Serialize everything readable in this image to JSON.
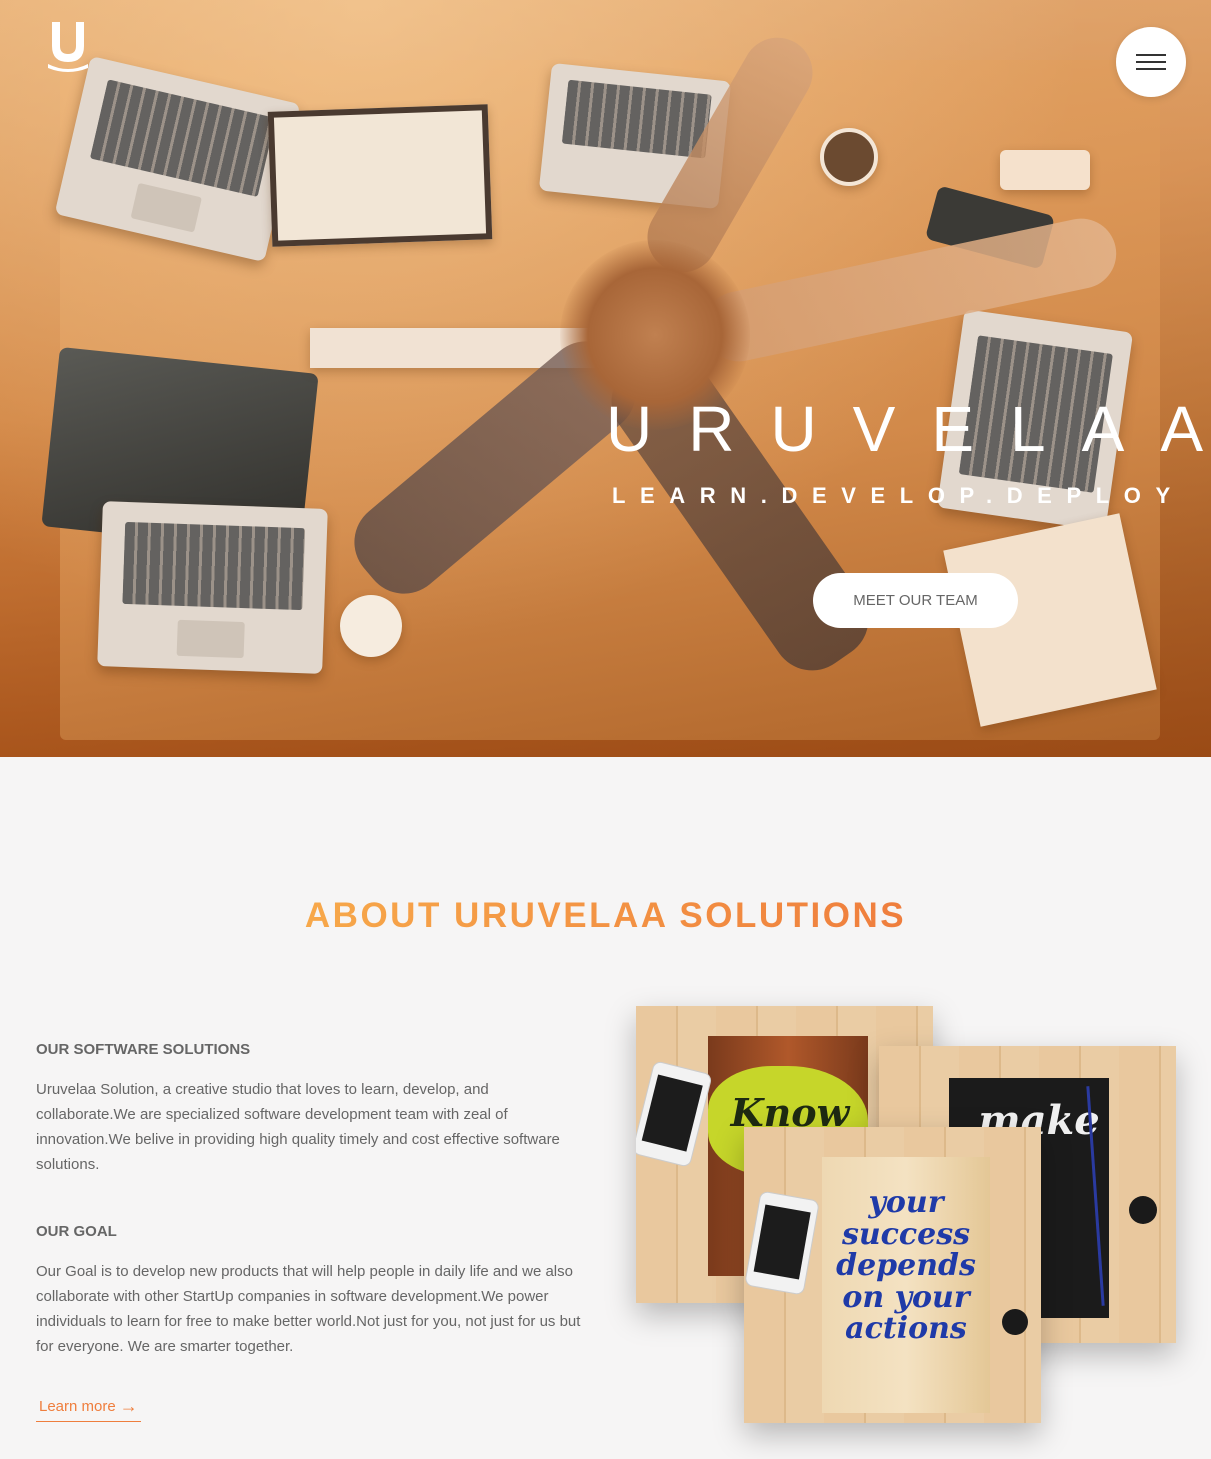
{
  "hero": {
    "brand_letter": "U",
    "title": "URUVELAA",
    "tagline": "LEARN.DEVELOP.DEPLOY",
    "cta_label": "MEET OUR TEAM",
    "overlay_colors": [
      "#fcc488",
      "#ec9646",
      "#aa5014"
    ]
  },
  "about": {
    "heading": "ABOUT URUVELAA SOLUTIONS",
    "heading_gradient": [
      "#f7a84a",
      "#ef7e3d"
    ],
    "sections": [
      {
        "title": "OUR SOFTWARE SOLUTIONS",
        "body": "Uruvelaa Solution, a creative studio that loves to learn, develop, and collaborate.We are specialized software development team with zeal of innovation.We belive in providing high quality timely and cost effective software solutions."
      },
      {
        "title": "OUR GOAL",
        "body": "Our Goal is to develop new products that will help people in daily life and we also collaborate with other StartUp companies in software development.We power individuals to learn for free to make better world.Not just for you, not just for us but for everyone. We are smarter together."
      }
    ],
    "learn_more": "Learn more",
    "learn_more_arrow": "→",
    "accent": "#ef7e3d"
  },
  "photos": [
    {
      "quote": "Know"
    },
    {
      "quote": "make"
    },
    {
      "quote": "your success depends on your actions"
    }
  ],
  "icons": {
    "logo": "uruvelaa-logo-icon",
    "menu": "hamburger-menu-icon"
  }
}
